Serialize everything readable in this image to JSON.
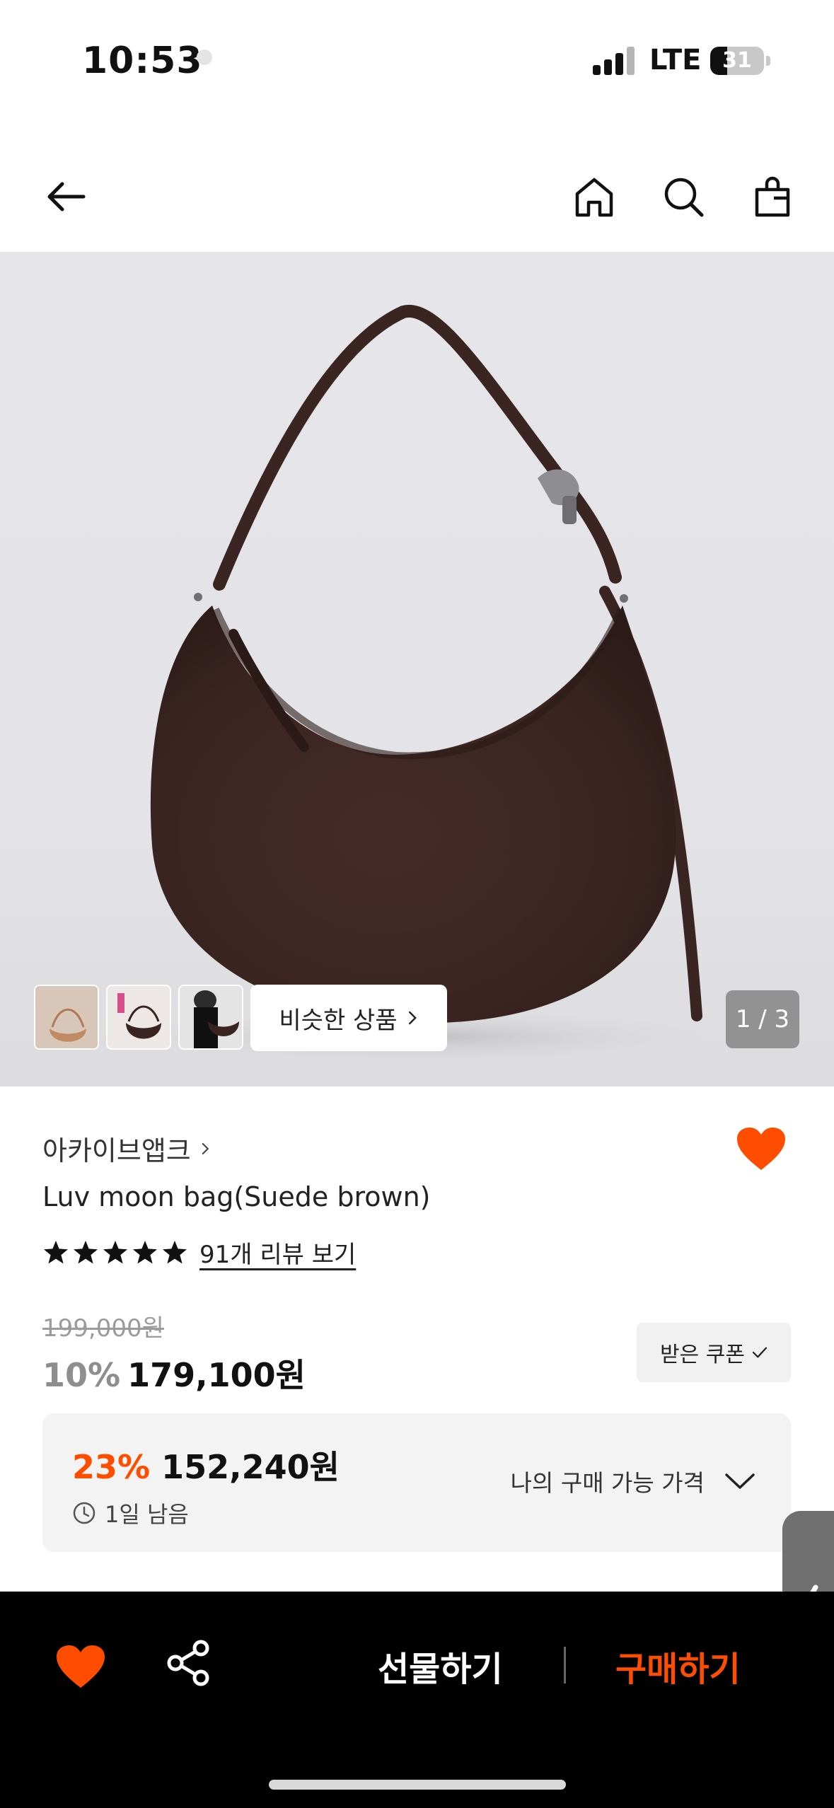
{
  "status_bar": {
    "time": "10:53",
    "network": "LTE",
    "battery_level": "31",
    "battery_fraction": 0.31
  },
  "nav": {
    "back_icon": "back-arrow-icon",
    "home_icon": "home-icon",
    "search_icon": "search-icon",
    "cart_icon": "shopping-bag-icon"
  },
  "gallery": {
    "thumbnails": [
      "thumbnail-1",
      "thumbnail-2",
      "thumbnail-3"
    ],
    "similar_label": "비슷한 상품",
    "page_counter": "1 / 3"
  },
  "product": {
    "brand": "아카이브앱크",
    "name": "Luv moon bag(Suede brown)",
    "rating_stars": 5,
    "review_link": "91개 리뷰 보기",
    "original_price": "199,000원",
    "discount": "10%",
    "sale_price": "179,100원",
    "coupon_label": "받은 쿠폰",
    "wishlisted": true
  },
  "my_price": {
    "discount": "23%",
    "price": "152,240원",
    "time_left": "1일 남음",
    "toggle_label": "나의 구매 가능 가격"
  },
  "bottom_bar": {
    "gift_label": "선물하기",
    "buy_label": "구매하기"
  },
  "colors": {
    "accent": "#ff4d00",
    "bottom_bar": "#000000",
    "bag_brown": "#3a2421"
  }
}
